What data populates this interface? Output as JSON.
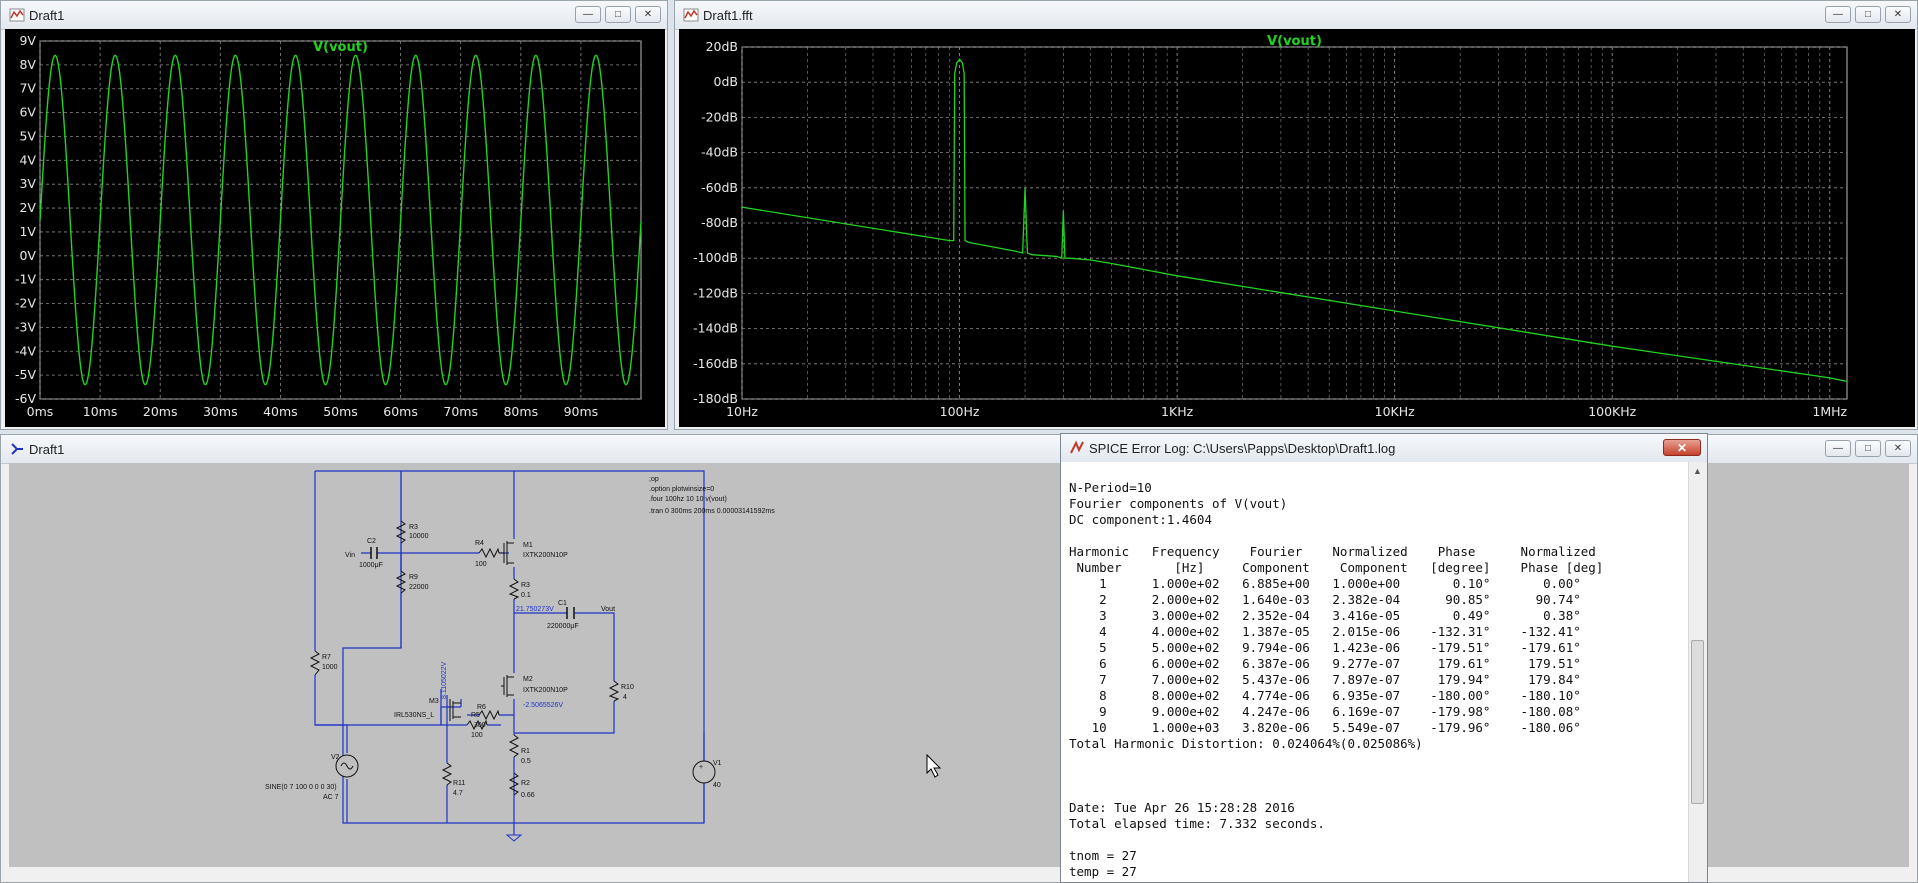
{
  "windows": {
    "transient": {
      "title": "Draft1"
    },
    "fft": {
      "title": "Draft1.fft"
    },
    "schematic": {
      "title": "Draft1"
    },
    "log": {
      "title": "SPICE Error Log: C:\\Users\\Papps\\Desktop\\Draft1.log"
    }
  },
  "transient_plot": {
    "trace_label": "V(vout)",
    "y_ticks": [
      "9V",
      "8V",
      "7V",
      "6V",
      "5V",
      "4V",
      "3V",
      "2V",
      "1V",
      "0V",
      "-1V",
      "-2V",
      "-3V",
      "-4V",
      "-5V",
      "-6V"
    ],
    "x_ticks": [
      "0ms",
      "10ms",
      "20ms",
      "30ms",
      "40ms",
      "50ms",
      "60ms",
      "70ms",
      "80ms",
      "90ms"
    ]
  },
  "fft_plot": {
    "trace_label": "V(vout)",
    "y_ticks": [
      "20dB",
      "0dB",
      "-20dB",
      "-40dB",
      "-60dB",
      "-80dB",
      "-100dB",
      "-120dB",
      "-140dB",
      "-160dB",
      "-180dB"
    ],
    "x_ticks": [
      "10Hz",
      "100Hz",
      "1KHz",
      "10KHz",
      "100KHz",
      "1MHz"
    ]
  },
  "chart_data": [
    {
      "type": "line",
      "series": [
        {
          "name": "V(vout)",
          "function": "sine",
          "frequency_hz": 100,
          "max": 8.4,
          "min": -5.4,
          "offset": 1.46
        }
      ],
      "x_range": [
        0,
        100
      ],
      "x_unit": "ms",
      "ylim": [
        -6,
        9
      ],
      "y_unit": "V",
      "grid": true
    },
    {
      "type": "line",
      "series": [
        {
          "name": "V(vout)",
          "x": [
            10,
            90,
            94,
            95,
            97,
            100,
            103,
            105,
            106,
            110,
            180,
            195,
            200,
            205,
            215,
            280,
            295,
            300,
            305,
            320,
            400,
            500,
            1000,
            10000,
            100000,
            1000000,
            1200000
          ],
          "y": [
            -71,
            -90,
            -90,
            5,
            11,
            13,
            11,
            5,
            -90,
            -91,
            -96,
            -97,
            -60,
            -97,
            -98,
            -99,
            -100,
            -73,
            -100,
            -100,
            -101,
            -103,
            -110,
            -130,
            -150,
            -168,
            -170
          ]
        }
      ],
      "xscale": "log",
      "x_range": [
        10,
        1200000
      ],
      "x_unit": "Hz",
      "ylim": [
        -180,
        20
      ],
      "y_unit": "dB",
      "grid": true
    }
  ],
  "schematic": {
    "directives": [
      ";op",
      ".option plotwinsize=0",
      ".four 100hz 10 10 v(vout)",
      ".tran 0 300ms 200ms 0.00003141592ms"
    ],
    "labels": {
      "r3": "R3",
      "r3v": "10000",
      "c2": "C2",
      "c2v": "1000μF",
      "vin": "Vin",
      "r4": "R4",
      "r4v": "100",
      "m1": "M1",
      "m1m": "IXTK200N10P",
      "r3b": "R3",
      "r3bv": "0.1",
      "r9": "R9",
      "r9v": "22000",
      "c1": "C1",
      "c1v": "220000μF",
      "vout": "Vout",
      "node1": "21.750273V",
      "node2": "8.1105022V",
      "node3": "-2.5065526V",
      "r7": "R7",
      "r7v": "1000",
      "r5": "R5",
      "r5v": "100",
      "m2": "M2",
      "m2m": "IXTK200N10P",
      "r10": "R10",
      "r10v": "4",
      "m3": "M3",
      "m3m": "IRL530NS_L",
      "r6": "R6",
      "r6v": "300",
      "r1": "R1",
      "r1v": "0.5",
      "v2": "V2",
      "v2v1": "SINE(0 7 100 0 0 0 30)",
      "v2v2": "AC 7",
      "r11": "R11",
      "r11v": "4.7",
      "r2": "R2",
      "r2v": "0.66",
      "v1": "V1",
      "v1v": "40"
    }
  },
  "log_lines": [
    "N-Period=10",
    "Fourier components of V(vout)",
    "DC component:1.4604",
    "",
    "Harmonic   Frequency    Fourier    Normalized    Phase      Normalized",
    " Number       [Hz]     Component    Component   [degree]    Phase [deg]",
    "    1      1.000e+02   6.885e+00   1.000e+00       0.10°       0.00°",
    "    2      2.000e+02   1.640e-03   2.382e-04      90.85°      90.74°",
    "    3      3.000e+02   2.352e-04   3.416e-05       0.49°       0.38°",
    "    4      4.000e+02   1.387e-05   2.015e-06    -132.31°    -132.41°",
    "    5      5.000e+02   9.794e-06   1.423e-06    -179.51°    -179.61°",
    "    6      6.000e+02   6.387e-06   9.277e-07     179.61°     179.51°",
    "    7      7.000e+02   5.437e-06   7.897e-07     179.94°     179.84°",
    "    8      8.000e+02   4.774e-06   6.935e-07    -180.00°    -180.10°",
    "    9      9.000e+02   4.247e-06   6.169e-07    -179.98°    -180.08°",
    "   10      1.000e+03   3.820e-06   5.549e-07    -179.96°    -180.06°",
    "Total Harmonic Distortion: 0.024064%(0.025086%)",
    "",
    "",
    "",
    "Date: Tue Apr 26 15:28:28 2016",
    "Total elapsed time: 7.332 seconds.",
    "",
    "tnom = 27",
    "temp = 27"
  ],
  "colors": {
    "trace": "#21d321",
    "wire": "#1e33c7",
    "plot_bg": "#000000",
    "grid": "#8a8a8a"
  }
}
